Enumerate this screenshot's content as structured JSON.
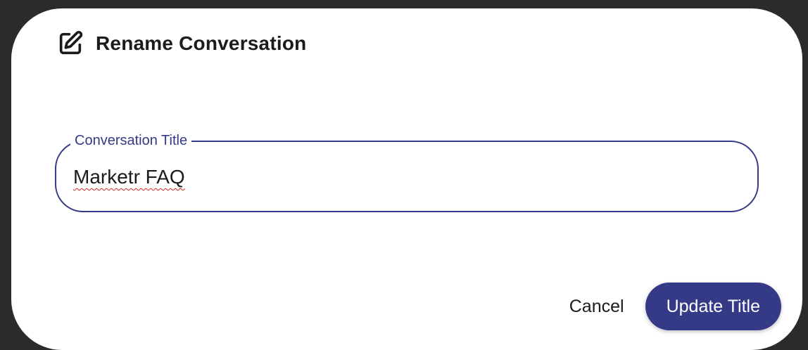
{
  "dialog": {
    "title": "Rename Conversation",
    "icon": "edit-icon"
  },
  "field": {
    "label": "Conversation Title",
    "value": "Marketr FAQ",
    "accent_color": "#343a86"
  },
  "actions": {
    "cancel_label": "Cancel",
    "submit_label": "Update Title",
    "submit_color": "#343a86"
  }
}
